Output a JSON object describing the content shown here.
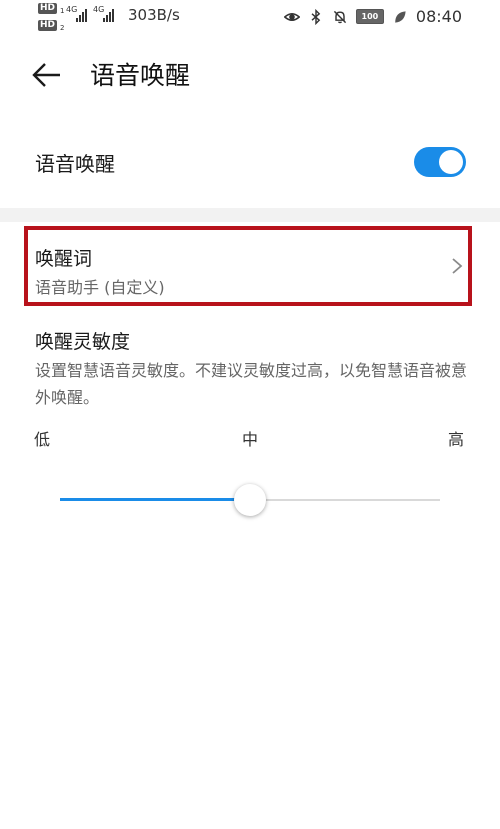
{
  "status_bar": {
    "hd1": "HD",
    "hd1_sub": "1",
    "hd2": "HD",
    "hd2_sub": "2",
    "net1": "4G",
    "net2": "4G",
    "speed": "303B/s",
    "battery": "100",
    "time": "08:40"
  },
  "header": {
    "title": "语音唤醒"
  },
  "toggle": {
    "label": "语音唤醒",
    "on": true
  },
  "wake_word": {
    "title": "唤醒词",
    "subtitle": "语音助手 (自定义)"
  },
  "sensitivity": {
    "title": "唤醒灵敏度",
    "description": "设置智慧语音灵敏度。不建议灵敏度过高，以免智慧语音被意外唤醒。",
    "low": "低",
    "mid": "中",
    "high": "高",
    "level": 0.5
  },
  "colors": {
    "accent": "#1a8ce8",
    "highlight": "#b8121b"
  }
}
